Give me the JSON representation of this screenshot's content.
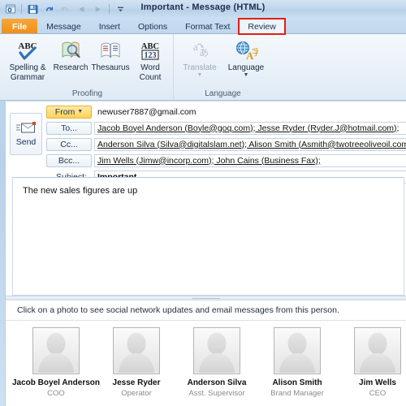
{
  "window": {
    "title": "Important  -  Message (HTML)",
    "quick_access": [
      {
        "name": "outlook-icon",
        "label": "Outlook"
      },
      {
        "name": "save-icon",
        "label": "Save"
      },
      {
        "name": "undo-icon",
        "label": "Undo"
      },
      {
        "name": "redo-icon",
        "label": "Redo"
      },
      {
        "name": "previous-item-icon",
        "label": "Previous Item"
      },
      {
        "name": "next-item-icon",
        "label": "Next Item"
      },
      {
        "name": "customize-qat-icon",
        "label": "Customize Quick Access Toolbar"
      }
    ]
  },
  "tabs": [
    {
      "label": "File",
      "style": "file"
    },
    {
      "label": "Message",
      "style": "normal"
    },
    {
      "label": "Insert",
      "style": "normal"
    },
    {
      "label": "Options",
      "style": "normal"
    },
    {
      "label": "Format Text",
      "style": "normal"
    },
    {
      "label": "Review",
      "style": "highlight"
    }
  ],
  "ribbon": {
    "groups": [
      {
        "label": "Proofing",
        "items": [
          {
            "label": "Spelling &\nGrammar",
            "line1": "Spelling &",
            "line2": "Grammar",
            "icon": "spelling-grammar-icon",
            "disabled": false,
            "dropdown": false
          },
          {
            "label": "Research",
            "line1": "Research",
            "line2": "",
            "icon": "research-icon",
            "disabled": false,
            "dropdown": false
          },
          {
            "label": "Thesaurus",
            "line1": "Thesaurus",
            "line2": "",
            "icon": "thesaurus-icon",
            "disabled": false,
            "dropdown": false
          },
          {
            "label": "Word Count",
            "line1": "Word",
            "line2": "Count",
            "icon": "word-count-icon",
            "disabled": false,
            "dropdown": false
          }
        ]
      },
      {
        "label": "Language",
        "items": [
          {
            "label": "Translate",
            "line1": "Translate",
            "line2": "",
            "icon": "translate-icon",
            "disabled": true,
            "dropdown": true
          },
          {
            "label": "Language",
            "line1": "Language",
            "line2": "",
            "icon": "language-icon",
            "disabled": false,
            "dropdown": true
          }
        ]
      }
    ]
  },
  "compose": {
    "send_button": "Send",
    "fields": [
      {
        "kind": "button",
        "label": "From",
        "dropdown": true,
        "highlight": true,
        "value": "newuser7887@gmail.com",
        "boxed": false,
        "underline": false,
        "name": "from"
      },
      {
        "kind": "button",
        "label": "To...",
        "dropdown": false,
        "highlight": false,
        "value": "Jacob Boyel Anderson (Boyle@goq.com); Jesse Ryder (Ryder.J@hotmail.com);",
        "boxed": true,
        "underline": true,
        "name": "to"
      },
      {
        "kind": "button",
        "label": "Cc...",
        "dropdown": false,
        "highlight": false,
        "value": "Anderson Silva (Silva@digitalslam.net); Alison Smith (Asmith@twotreeoliveoil.com);",
        "boxed": true,
        "underline": true,
        "name": "cc"
      },
      {
        "kind": "button",
        "label": "Bcc...",
        "dropdown": false,
        "highlight": false,
        "value": "Jim Wells (Jimw@incorp.com); John Cains (Business Fax);",
        "boxed": true,
        "underline": true,
        "name": "bcc"
      },
      {
        "kind": "label",
        "label": "Subject:",
        "dropdown": false,
        "highlight": false,
        "value": "Important",
        "boxed": true,
        "underline": false,
        "name": "subject"
      }
    ],
    "body_text": "The new sales figures are up"
  },
  "people_pane": {
    "hint": "Click on a photo to see social network updates and email messages from this person.",
    "contacts": [
      {
        "name": "Jacob Boyel Anderson",
        "title": "COO"
      },
      {
        "name": "Jesse Ryder",
        "title": "Operator"
      },
      {
        "name": "Anderson Silva",
        "title": "Asst. Supervisor"
      },
      {
        "name": "Alison Smith",
        "title": "Brand Manager"
      },
      {
        "name": "Jim Wells",
        "title": "CEO"
      }
    ]
  },
  "colors": {
    "file_tab": "#ef8f16",
    "highlight_box": "#e21d13",
    "from_button": "#ffd257",
    "title_text": "#1b2d4a"
  }
}
